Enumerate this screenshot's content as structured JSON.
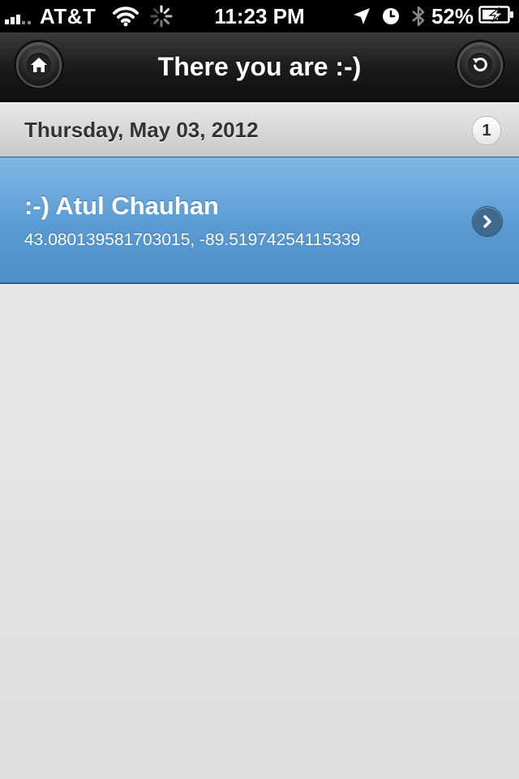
{
  "status_bar": {
    "carrier": "AT&T",
    "time": "11:23 PM",
    "battery_percent": "52",
    "percent_sign": "%",
    "icons": [
      "signal-bars-icon",
      "wifi-icon",
      "activity-spinner-icon",
      "location-arrow-icon",
      "alarm-clock-icon",
      "bluetooth-icon",
      "battery-charging-icon"
    ]
  },
  "header": {
    "title": "There you are :-)",
    "left_button_icon": "home-icon",
    "right_button_icon": "refresh-icon"
  },
  "list": {
    "divider": {
      "label": "Thursday, May 03, 2012",
      "count": "1"
    },
    "items": [
      {
        "name": ":-) Atul Chauhan",
        "coords": "43.080139581703015, -89.51974254115339",
        "icon": "chevron-right-icon"
      }
    ]
  },
  "colors": {
    "header_bg": "#1c1c1c",
    "divider_bg": "#d4d4d4",
    "item_bg": "#5a9bd3",
    "page_bg": "#e6e6e6"
  }
}
